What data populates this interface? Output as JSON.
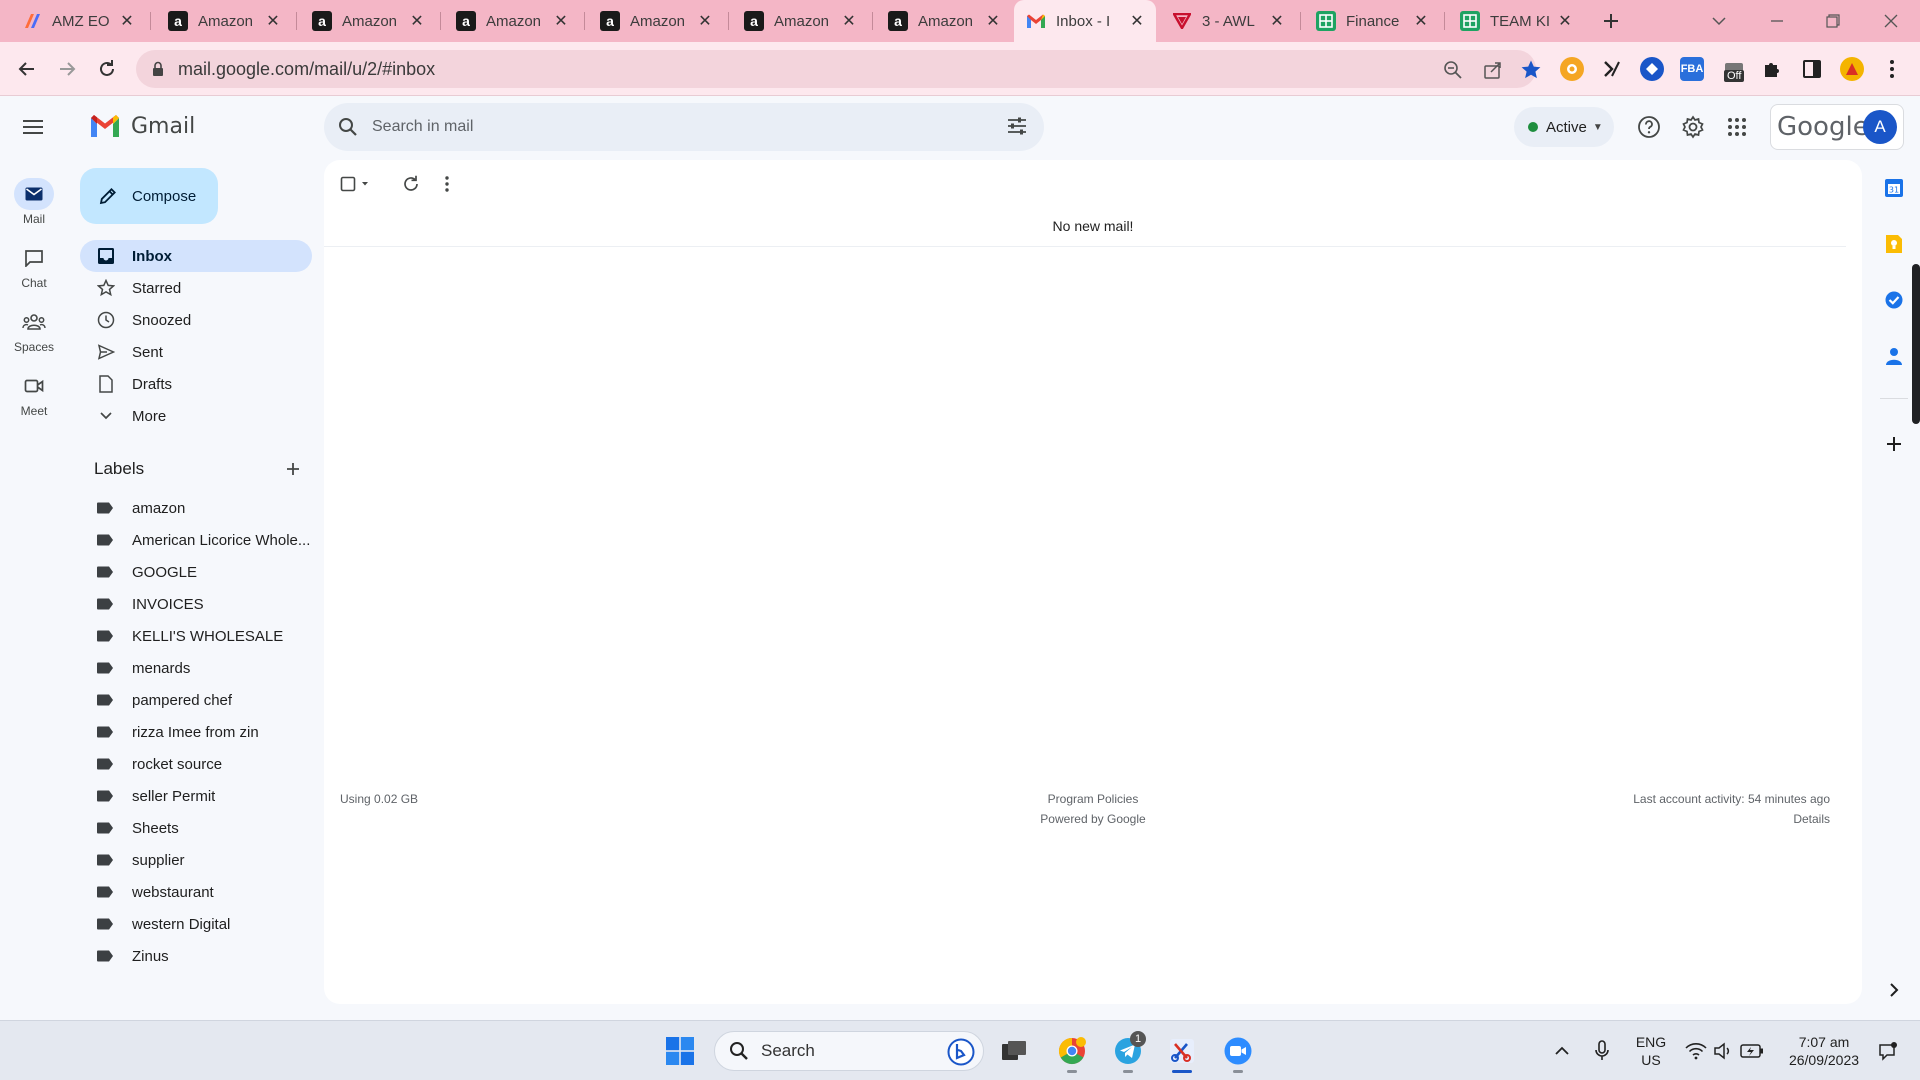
{
  "browser": {
    "tabs": [
      {
        "title": "AMZ EO",
        "icon": "amz-eo-icon"
      },
      {
        "title": "Amazon",
        "icon": "amazon-icon"
      },
      {
        "title": "Amazon",
        "icon": "amazon-icon"
      },
      {
        "title": "Amazon",
        "icon": "amazon-icon"
      },
      {
        "title": "Amazon",
        "icon": "amazon-icon"
      },
      {
        "title": "Amazon",
        "icon": "amazon-icon"
      },
      {
        "title": "Amazon",
        "icon": "amazon-icon"
      },
      {
        "title": "Inbox - I",
        "icon": "gmail-icon"
      },
      {
        "title": "3 - AWL",
        "icon": "awl-icon"
      },
      {
        "title": "Finance",
        "icon": "sheets-icon"
      },
      {
        "title": "TEAM KI",
        "icon": "sheets-icon"
      }
    ],
    "active_tab_index": 7,
    "url": "mail.google.com/mail/u/2/#inbox",
    "extension_badge": "Off",
    "colors": {
      "tabstrip": "#f4b6c6",
      "toolbar": "#fde8ee",
      "omnibox": "#f3d4dc"
    }
  },
  "gmail": {
    "brand": "Gmail",
    "search_placeholder": "Search in mail",
    "status": "Active",
    "account_brand": "Google",
    "account_initial": "A",
    "compose_label": "Compose",
    "rail": [
      {
        "label": "Mail",
        "icon": "mail-icon"
      },
      {
        "label": "Chat",
        "icon": "chat-icon"
      },
      {
        "label": "Spaces",
        "icon": "spaces-icon"
      },
      {
        "label": "Meet",
        "icon": "meet-icon"
      }
    ],
    "nav": [
      {
        "label": "Inbox",
        "icon": "inbox-icon",
        "selected": true
      },
      {
        "label": "Starred",
        "icon": "star-icon"
      },
      {
        "label": "Snoozed",
        "icon": "clock-icon"
      },
      {
        "label": "Sent",
        "icon": "send-icon"
      },
      {
        "label": "Drafts",
        "icon": "draft-icon"
      },
      {
        "label": "More",
        "icon": "chevron-down-icon"
      }
    ],
    "labels_heading": "Labels",
    "labels": [
      "amazon",
      "American Licorice Whole...",
      "GOOGLE",
      "INVOICES",
      "KELLI'S WHOLESALE",
      "menards",
      "pampered chef",
      "rizza Imee from zin",
      "rocket source",
      "seller Permit",
      "Sheets",
      "supplier",
      "webstaurant",
      "western Digital",
      "Zinus"
    ],
    "empty_message": "No new mail!",
    "footer": {
      "storage": "Using 0.02 GB",
      "program_policies": "Program Policies",
      "powered_by": "Powered by Google",
      "last_activity": "Last account activity: 54 minutes ago",
      "details": "Details"
    },
    "colors": {
      "accent": "#0b57d0",
      "selected_nav": "#d3e3fd",
      "compose": "#c2e7ff",
      "active_dot": "#1e8e3e"
    }
  },
  "taskbar": {
    "search_label": "Search",
    "telegram_badge": "1",
    "language": "ENG",
    "region": "US",
    "time": "7:07 am",
    "date": "26/09/2023"
  }
}
